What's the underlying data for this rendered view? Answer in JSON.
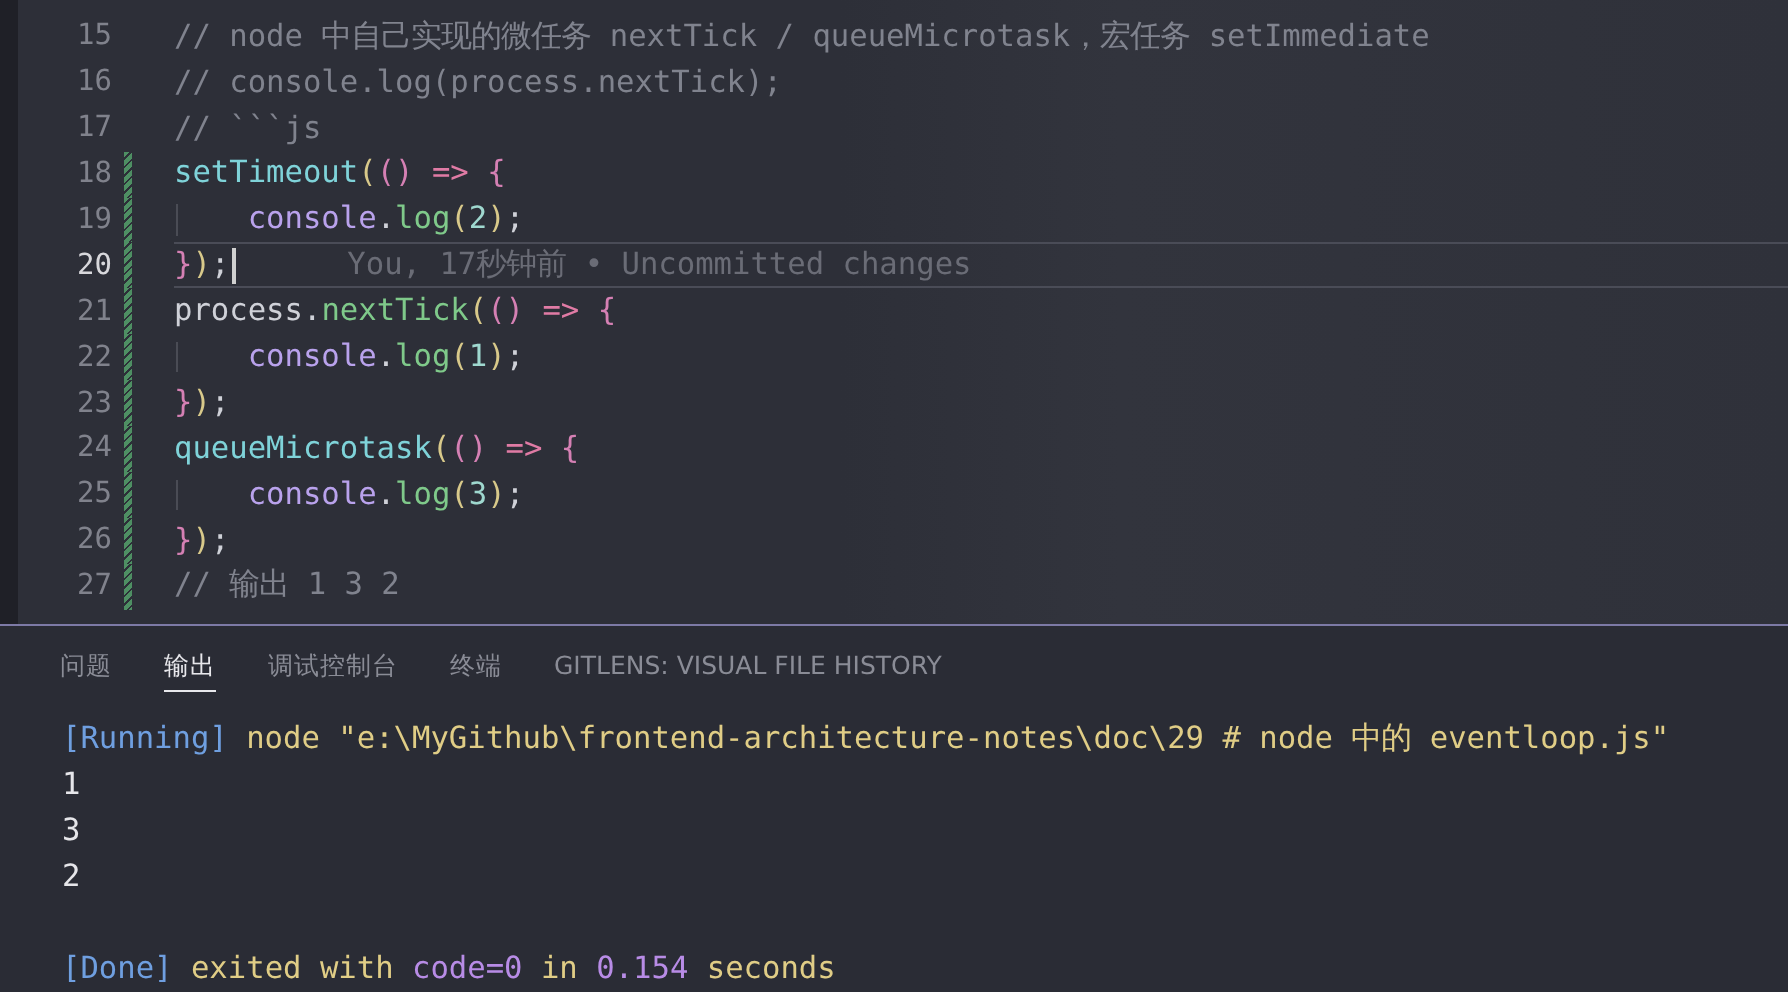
{
  "editor": {
    "lines": [
      {
        "number": "15",
        "changed": false,
        "current": false,
        "tokens": [
          {
            "kind": "comment",
            "text": "// node 中自己实现的微任务 nextTick / queueMicrotask，宏任务 setImmediate"
          }
        ]
      },
      {
        "number": "16",
        "changed": false,
        "current": false,
        "tokens": [
          {
            "kind": "comment",
            "text": "// console.log(process.nextTick);"
          }
        ]
      },
      {
        "number": "17",
        "changed": false,
        "current": false,
        "tokens": [
          {
            "kind": "comment",
            "text": "// ```js"
          }
        ]
      },
      {
        "number": "18",
        "changed": true,
        "current": false,
        "tokens": [
          {
            "kind": "func",
            "text": "setTimeout"
          },
          {
            "kind": "paren",
            "text": "("
          },
          {
            "kind": "bracket",
            "text": "()"
          },
          {
            "kind": "arrow",
            "text": " => "
          },
          {
            "kind": "bracket",
            "text": "{"
          }
        ]
      },
      {
        "number": "19",
        "changed": true,
        "current": false,
        "tokens": [
          {
            "kind": "object",
            "text": "    console"
          },
          {
            "kind": "plain",
            "text": "."
          },
          {
            "kind": "method",
            "text": "log"
          },
          {
            "kind": "paren",
            "text": "("
          },
          {
            "kind": "number",
            "text": "2"
          },
          {
            "kind": "paren",
            "text": ")"
          },
          {
            "kind": "plain",
            "text": ";"
          }
        ]
      },
      {
        "number": "20",
        "changed": true,
        "current": true,
        "blame": "You, 17秒钟前 • Uncommitted changes",
        "tokens": [
          {
            "kind": "bracket",
            "text": "}"
          },
          {
            "kind": "paren",
            "text": ")"
          },
          {
            "kind": "plain",
            "text": ";"
          }
        ]
      },
      {
        "number": "21",
        "changed": true,
        "current": false,
        "tokens": [
          {
            "kind": "plain",
            "text": "process."
          },
          {
            "kind": "method",
            "text": "nextTick"
          },
          {
            "kind": "paren",
            "text": "("
          },
          {
            "kind": "bracket",
            "text": "()"
          },
          {
            "kind": "arrow",
            "text": " => "
          },
          {
            "kind": "bracket",
            "text": "{"
          }
        ]
      },
      {
        "number": "22",
        "changed": true,
        "current": false,
        "tokens": [
          {
            "kind": "object",
            "text": "    console"
          },
          {
            "kind": "plain",
            "text": "."
          },
          {
            "kind": "method",
            "text": "log"
          },
          {
            "kind": "paren",
            "text": "("
          },
          {
            "kind": "number",
            "text": "1"
          },
          {
            "kind": "paren",
            "text": ")"
          },
          {
            "kind": "plain",
            "text": ";"
          }
        ]
      },
      {
        "number": "23",
        "changed": true,
        "current": false,
        "tokens": [
          {
            "kind": "bracket",
            "text": "}"
          },
          {
            "kind": "paren",
            "text": ")"
          },
          {
            "kind": "plain",
            "text": ";"
          }
        ]
      },
      {
        "number": "24",
        "changed": true,
        "current": false,
        "tokens": [
          {
            "kind": "func",
            "text": "queueMicrotask"
          },
          {
            "kind": "paren",
            "text": "("
          },
          {
            "kind": "bracket",
            "text": "()"
          },
          {
            "kind": "arrow",
            "text": " => "
          },
          {
            "kind": "bracket",
            "text": "{"
          }
        ]
      },
      {
        "number": "25",
        "changed": true,
        "current": false,
        "tokens": [
          {
            "kind": "object",
            "text": "    console"
          },
          {
            "kind": "plain",
            "text": "."
          },
          {
            "kind": "method",
            "text": "log"
          },
          {
            "kind": "paren",
            "text": "("
          },
          {
            "kind": "number",
            "text": "3"
          },
          {
            "kind": "paren",
            "text": ")"
          },
          {
            "kind": "plain",
            "text": ";"
          }
        ]
      },
      {
        "number": "26",
        "changed": true,
        "current": false,
        "tokens": [
          {
            "kind": "bracket",
            "text": "}"
          },
          {
            "kind": "paren",
            "text": ")"
          },
          {
            "kind": "plain",
            "text": ";"
          }
        ]
      },
      {
        "number": "27",
        "changed": true,
        "current": false,
        "tokens": [
          {
            "kind": "comment",
            "text": "// 输出 1 3 2"
          }
        ]
      }
    ]
  },
  "panel": {
    "tabs": [
      {
        "label": "问题",
        "selected": false
      },
      {
        "label": "输出",
        "selected": true
      },
      {
        "label": "调试控制台",
        "selected": false
      },
      {
        "label": "终端",
        "selected": false
      },
      {
        "label": "GITLENS: VISUAL FILE HISTORY",
        "selected": false
      }
    ],
    "output": {
      "header": [
        {
          "kind": "tag",
          "text": "[Running]"
        },
        {
          "kind": "text",
          "text": " node \"e:\\MyGithub\\frontend-architecture-notes\\doc\\29 # node 中的 eventloop.js\""
        }
      ],
      "results": [
        "1",
        "3",
        "2"
      ],
      "footer": [
        {
          "kind": "tag",
          "text": "[Done]"
        },
        {
          "kind": "text",
          "text": " exited with "
        },
        {
          "kind": "value",
          "text": "code=0"
        },
        {
          "kind": "text",
          "text": " in "
        },
        {
          "kind": "value",
          "text": "0.154"
        },
        {
          "kind": "text",
          "text": " seconds"
        }
      ]
    }
  }
}
